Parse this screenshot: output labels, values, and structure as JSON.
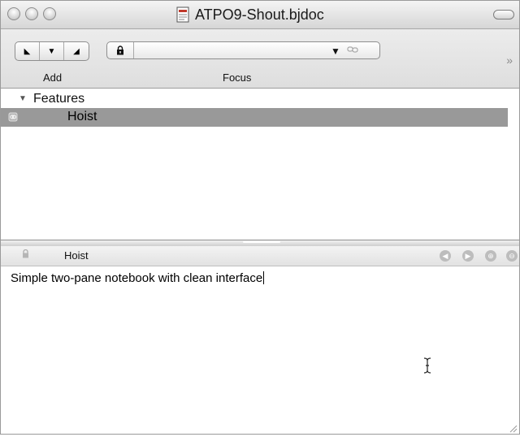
{
  "window": {
    "title": "ATPO9-Shout.bjdoc",
    "doc_icon": "bjdoc-document-icon"
  },
  "toolbar": {
    "move_buttons": [
      {
        "icon": "move-left-down-icon",
        "glyph": "◣"
      },
      {
        "icon": "move-down-icon",
        "glyph": "▼"
      },
      {
        "icon": "move-right-down-icon",
        "glyph": "◢"
      }
    ],
    "add_label": "Add",
    "focus_label": "Focus",
    "lock_glyph": "🔒",
    "combo_arrow": "▼",
    "link_glyph": "🔗",
    "overflow_glyph": "»"
  },
  "outline": {
    "group_label": "Features",
    "disclosure_glyph": "▼",
    "selected_item": "Hoist"
  },
  "note": {
    "header_title": "Hoist",
    "nav_buttons": [
      "◀",
      "▶",
      "⊕",
      "⊖"
    ],
    "body_text": "Simple two-pane notebook with clean interface"
  },
  "colors": {
    "selection": "#999999",
    "window_bg": "#ffffff"
  }
}
